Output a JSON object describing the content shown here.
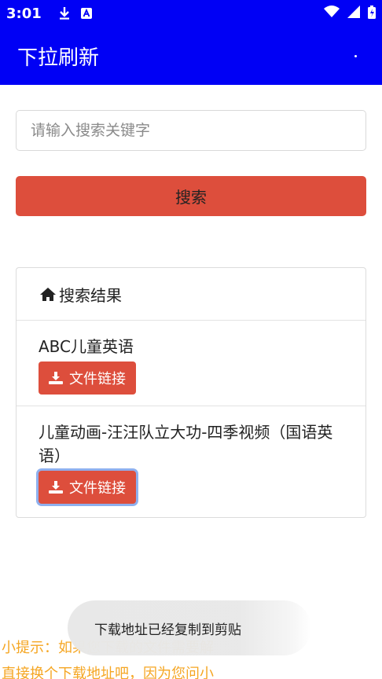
{
  "status_bar": {
    "time": "3:01",
    "icons": [
      "download-icon",
      "a-badge-icon",
      "wifi-icon",
      "signal-icon",
      "battery-icon"
    ]
  },
  "app_bar": {
    "title": "下拉刷新",
    "menu_icon": "overflow-dot-icon"
  },
  "search": {
    "placeholder": "请输入搜索关键字",
    "value": "",
    "button_label": "搜索"
  },
  "results": {
    "header": "搜索结果",
    "header_icon": "home-icon",
    "items": [
      {
        "name": "ABC儿童英语",
        "link_label": "文件链接"
      },
      {
        "name": "儿童动画-汪汪队立大功-四季视频（国语英语）",
        "link_label": "文件链接"
      }
    ]
  },
  "tip": {
    "line1": "小提示：如果您下载的文件需要解",
    "line2": "直接换个下载地址吧，因为您问小"
  },
  "toast": {
    "text": "下载地址已经复制到剪贴"
  },
  "colors": {
    "primary": "#0000f5",
    "danger": "#dd4e3c",
    "tip": "#f5a623"
  }
}
